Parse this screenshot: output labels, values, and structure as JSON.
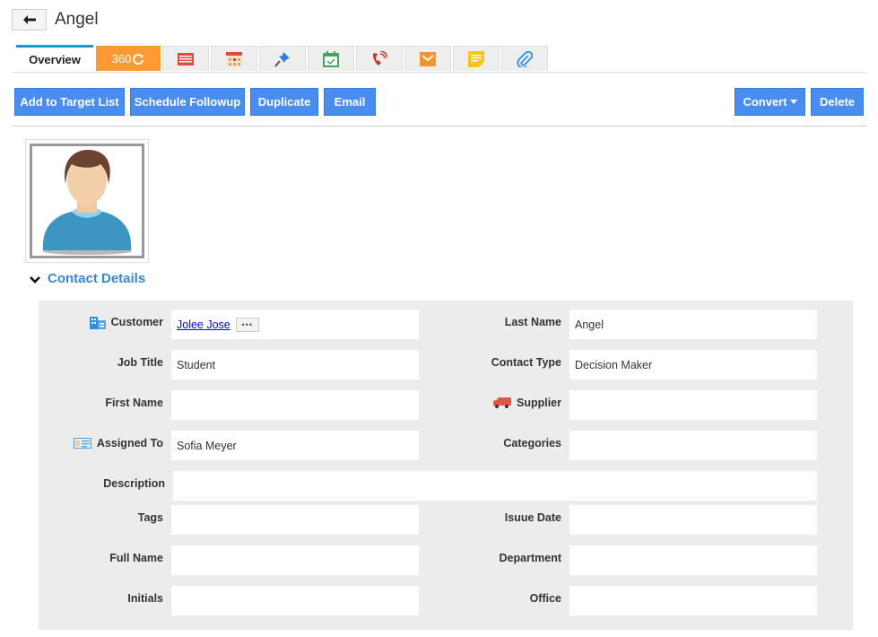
{
  "header": {
    "title": "Angel",
    "back_icon": "arrow-left-icon"
  },
  "tabs": [
    {
      "id": "overview",
      "label": "Overview",
      "active": true
    },
    {
      "id": "360",
      "label": "360",
      "icon": "refresh-icon",
      "color": "#ff9933"
    },
    {
      "id": "notes-list",
      "icon": "list-card-icon"
    },
    {
      "id": "calendar",
      "icon": "calendar-icon"
    },
    {
      "id": "pin",
      "icon": "pin-icon"
    },
    {
      "id": "tasks",
      "icon": "calendar-check-icon"
    },
    {
      "id": "calls",
      "icon": "phone-icon"
    },
    {
      "id": "emails",
      "icon": "envelope-icon"
    },
    {
      "id": "sticky-notes",
      "icon": "sticky-note-icon"
    },
    {
      "id": "attachments",
      "icon": "paperclip-icon"
    }
  ],
  "toolbar": {
    "add_to_target_list": "Add to Target List",
    "schedule_followup": "Schedule Followup",
    "duplicate": "Duplicate",
    "email": "Email",
    "convert": "Convert",
    "delete": "Delete"
  },
  "section": {
    "title": "Contact Details"
  },
  "fields": {
    "customer": {
      "label": "Customer",
      "value": "Jolee Jose",
      "more": "•••"
    },
    "last_name": {
      "label": "Last Name",
      "value": "Angel"
    },
    "job_title": {
      "label": "Job Title",
      "value": "Student"
    },
    "contact_type": {
      "label": "Contact Type",
      "value": "Decision Maker"
    },
    "first_name": {
      "label": "First Name",
      "value": ""
    },
    "supplier": {
      "label": "Supplier",
      "value": ""
    },
    "assigned_to": {
      "label": "Assigned To",
      "value": "Sofia Meyer"
    },
    "categories": {
      "label": "Categories",
      "value": ""
    },
    "description": {
      "label": "Description",
      "value": ""
    },
    "tags": {
      "label": "Tags",
      "value": ""
    },
    "issue_date": {
      "label": "Isuue Date",
      "value": ""
    },
    "full_name": {
      "label": "Full Name",
      "value": ""
    },
    "department": {
      "label": "Department",
      "value": ""
    },
    "initials": {
      "label": "Initials",
      "value": ""
    },
    "office": {
      "label": "Office",
      "value": ""
    }
  },
  "colors": {
    "accent_blue": "#4a8df0",
    "tab_active": "#1a9bd7",
    "section_title": "#3b85d8",
    "tab_360": "#ff9933"
  }
}
